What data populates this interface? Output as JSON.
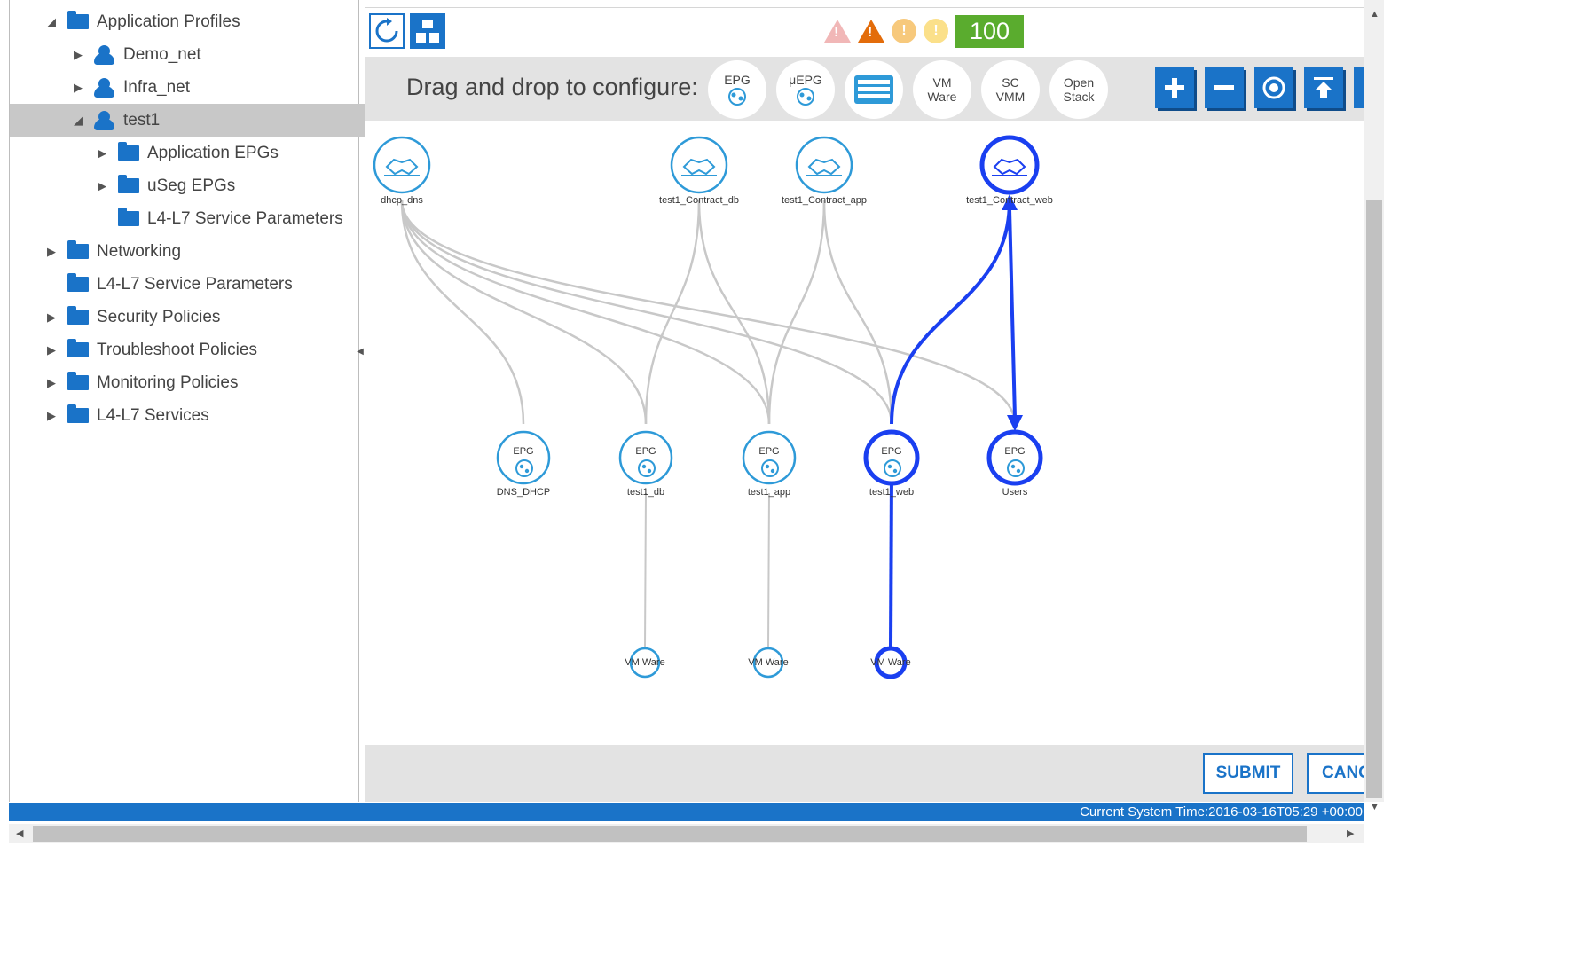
{
  "tree": {
    "items": [
      {
        "label": "Application Profiles",
        "toggle": "◢",
        "icon": "folder"
      },
      {
        "label": "Demo_net",
        "toggle": "▶",
        "icon": "app-profile"
      },
      {
        "label": "Infra_net",
        "toggle": "▶",
        "icon": "app-profile"
      },
      {
        "label": "test1",
        "toggle": "◢",
        "icon": "app-profile",
        "selected": true
      },
      {
        "label": "Application EPGs",
        "toggle": "▶",
        "icon": "folder"
      },
      {
        "label": "uSeg EPGs",
        "toggle": "▶",
        "icon": "folder"
      },
      {
        "label": "L4-L7 Service Parameters",
        "toggle": "",
        "icon": "folder"
      },
      {
        "label": "Networking",
        "toggle": "▶",
        "icon": "folder"
      },
      {
        "label": "L4-L7 Service Parameters",
        "toggle": "",
        "icon": "folder"
      },
      {
        "label": "Security Policies",
        "toggle": "▶",
        "icon": "folder"
      },
      {
        "label": "Troubleshoot Policies",
        "toggle": "▶",
        "icon": "folder"
      },
      {
        "label": "Monitoring Policies",
        "toggle": "▶",
        "icon": "folder"
      },
      {
        "label": "L4-L7 Services",
        "toggle": "▶",
        "icon": "folder"
      }
    ]
  },
  "toolbar": {
    "refresh_icon": "refresh-icon",
    "layout_icon": "topology-layout-icon",
    "health_score": "100",
    "alerts": [
      {
        "type": "critical-outline",
        "color": "#e8a0a0"
      },
      {
        "type": "major",
        "color": "#e36c0a"
      },
      {
        "type": "minor",
        "color": "#f7c97c"
      },
      {
        "type": "warning",
        "color": "#fbe08a"
      }
    ]
  },
  "dnd": {
    "label": "Drag and drop to configure:",
    "palette": [
      {
        "line1": "EPG",
        "line2": ""
      },
      {
        "line1": "μEPG",
        "line2": ""
      },
      {
        "line1": "",
        "line2": "",
        "icon": "server-icon"
      },
      {
        "line1": "VM",
        "line2": "Ware"
      },
      {
        "line1": "SC",
        "line2": "VMM"
      },
      {
        "line1": "Open",
        "line2": "Stack"
      }
    ],
    "tool_icons": [
      "zoom-in-icon",
      "zoom-out-icon",
      "fit-icon",
      "top-icon",
      "more-icon"
    ]
  },
  "topology": {
    "contracts": [
      {
        "label": "dhcp_dns",
        "highlighted": false
      },
      {
        "label": "test1_Contract_db",
        "highlighted": false
      },
      {
        "label": "test1_Contract_app",
        "highlighted": false
      },
      {
        "label": "test1_Contract_web",
        "highlighted": true
      }
    ],
    "epgs": [
      {
        "label": "DNS_DHCP",
        "tag": "EPG",
        "highlighted": false
      },
      {
        "label": "test1_db",
        "tag": "EPG",
        "highlighted": false
      },
      {
        "label": "test1_app",
        "tag": "EPG",
        "highlighted": false
      },
      {
        "label": "test1_web",
        "tag": "EPG",
        "highlighted": true
      },
      {
        "label": "Users",
        "tag": "EPG",
        "highlighted": true
      }
    ],
    "vmm": [
      {
        "label": "VM Ware",
        "highlighted": false
      },
      {
        "label": "VM Ware",
        "highlighted": false
      },
      {
        "label": "VM Ware",
        "highlighted": true
      }
    ],
    "colors": {
      "link": "#c8c8c8",
      "highlight": "#1a3ff0",
      "node": "#2e9ad8"
    }
  },
  "footer": {
    "submit": "SUBMIT",
    "cancel": "CANC"
  },
  "status": {
    "time": "Current System Time:2016-03-16T05:29 +00:00"
  }
}
